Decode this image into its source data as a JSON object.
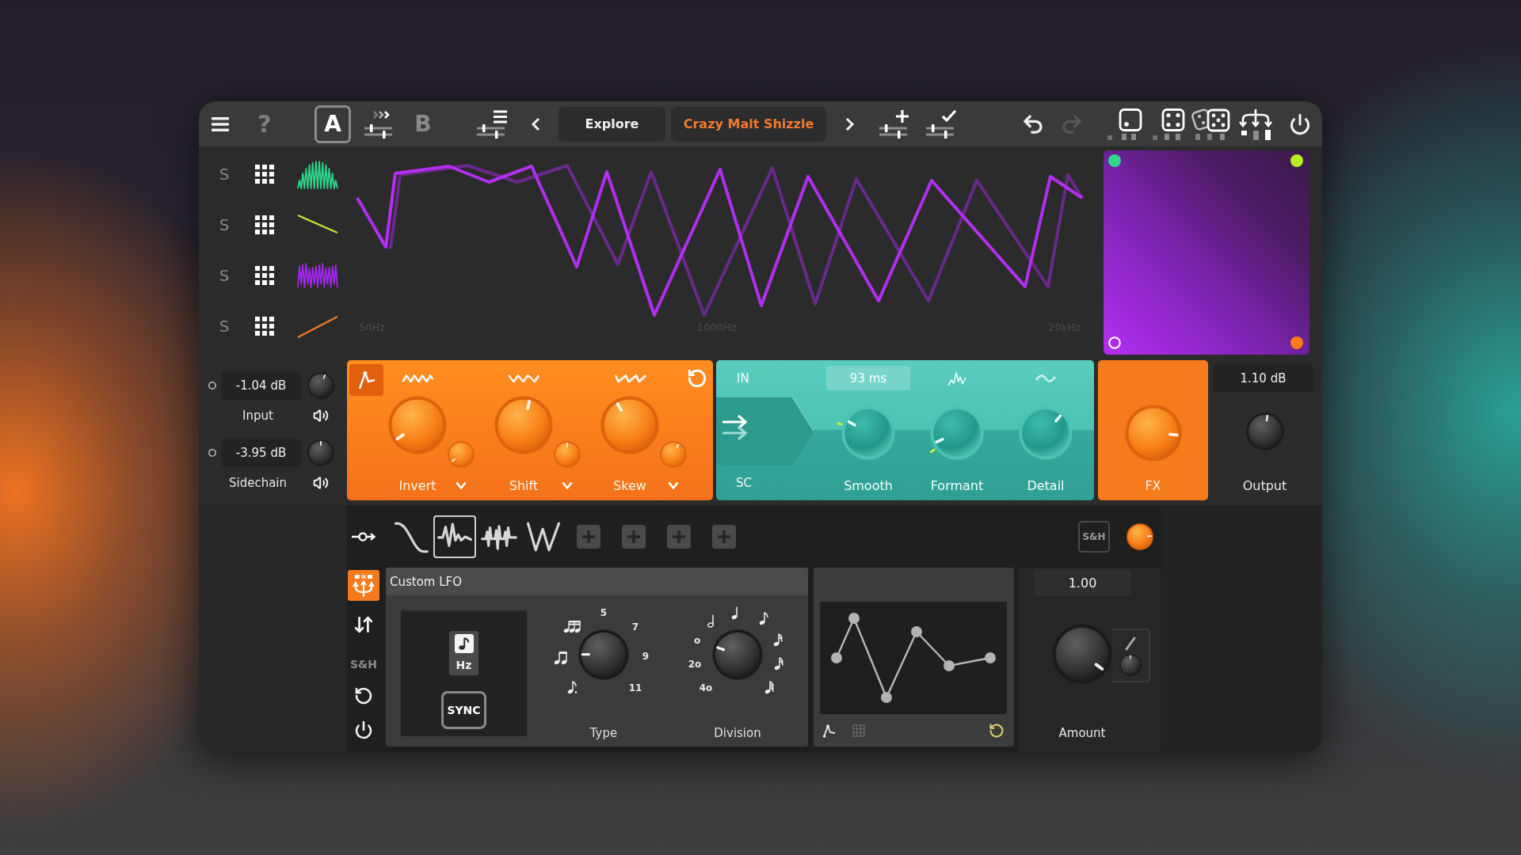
{
  "toolbar": {
    "help": "?",
    "slots": [
      {
        "label": "A",
        "selected": true
      },
      {
        "label": "B",
        "selected": false
      }
    ],
    "browse_button": "Explore",
    "preset_name": "Crazy Malt Shizzle",
    "redo_disabled": true
  },
  "layers": [
    {
      "solo": "S",
      "soloed": false,
      "kind": "burst",
      "color": "#2fd68c"
    },
    {
      "solo": "S",
      "soloed": false,
      "kind": "ramp-down",
      "color": "#c8e83a"
    },
    {
      "solo": "S",
      "soloed": false,
      "kind": "noise",
      "color": "#a526f0"
    },
    {
      "solo": "S",
      "soloed": false,
      "kind": "ramp-up",
      "color": "#f07a22"
    }
  ],
  "spectrum": {
    "axis_labels": [
      "50Hz",
      "1000Hz",
      "20kHz"
    ]
  },
  "xy_pad": {
    "corners": [
      {
        "kind": "dot",
        "color": "#2fd68c"
      },
      {
        "kind": "dot",
        "color": "#b8ee22"
      },
      {
        "kind": "ring",
        "color": "#ffffff"
      },
      {
        "kind": "dot",
        "color": "#ff7a1a"
      }
    ]
  },
  "inputs": [
    {
      "value": "-1.04 dB",
      "label": "Input",
      "active": false
    },
    {
      "value": "-3.95 dB",
      "label": "Sidechain",
      "active": false
    }
  ],
  "shaper": {
    "controls": [
      {
        "label": "Invert"
      },
      {
        "label": "Shift"
      },
      {
        "label": "Skew"
      }
    ]
  },
  "filter": {
    "in_label": "IN",
    "sc_label": "SC",
    "time": "93 ms",
    "knobs": [
      {
        "label": "Smooth",
        "modulated": true
      },
      {
        "label": "Formant",
        "modulated": true
      },
      {
        "label": "Detail",
        "modulated": false
      }
    ]
  },
  "fx": {
    "label": "FX"
  },
  "output": {
    "value": "1.10 dB",
    "label": "Output"
  },
  "lfo_slots": [
    {
      "kind": "curve",
      "selected": false
    },
    {
      "kind": "custom",
      "selected": true
    },
    {
      "kind": "spikes",
      "selected": false
    },
    {
      "kind": "zigzag",
      "selected": false
    },
    {
      "kind": "add",
      "selected": false
    },
    {
      "kind": "add",
      "selected": false
    },
    {
      "kind": "add",
      "selected": false
    },
    {
      "kind": "add",
      "selected": false
    }
  ],
  "sample_hold": {
    "label": "S&H"
  },
  "side_tools": {
    "routing_selected": true,
    "sample_hold_label": "S&H"
  },
  "lfo": {
    "title": "Custom LFO",
    "unit": "Hz",
    "sync_label": "SYNC",
    "type": {
      "label": "Type",
      "ticks": [
        "5",
        "7",
        "9",
        "11"
      ]
    },
    "division": {
      "label": "Division",
      "ticks": [
        "o",
        "2o",
        "4o"
      ]
    }
  },
  "amount": {
    "value": "1.00",
    "label": "Amount"
  }
}
